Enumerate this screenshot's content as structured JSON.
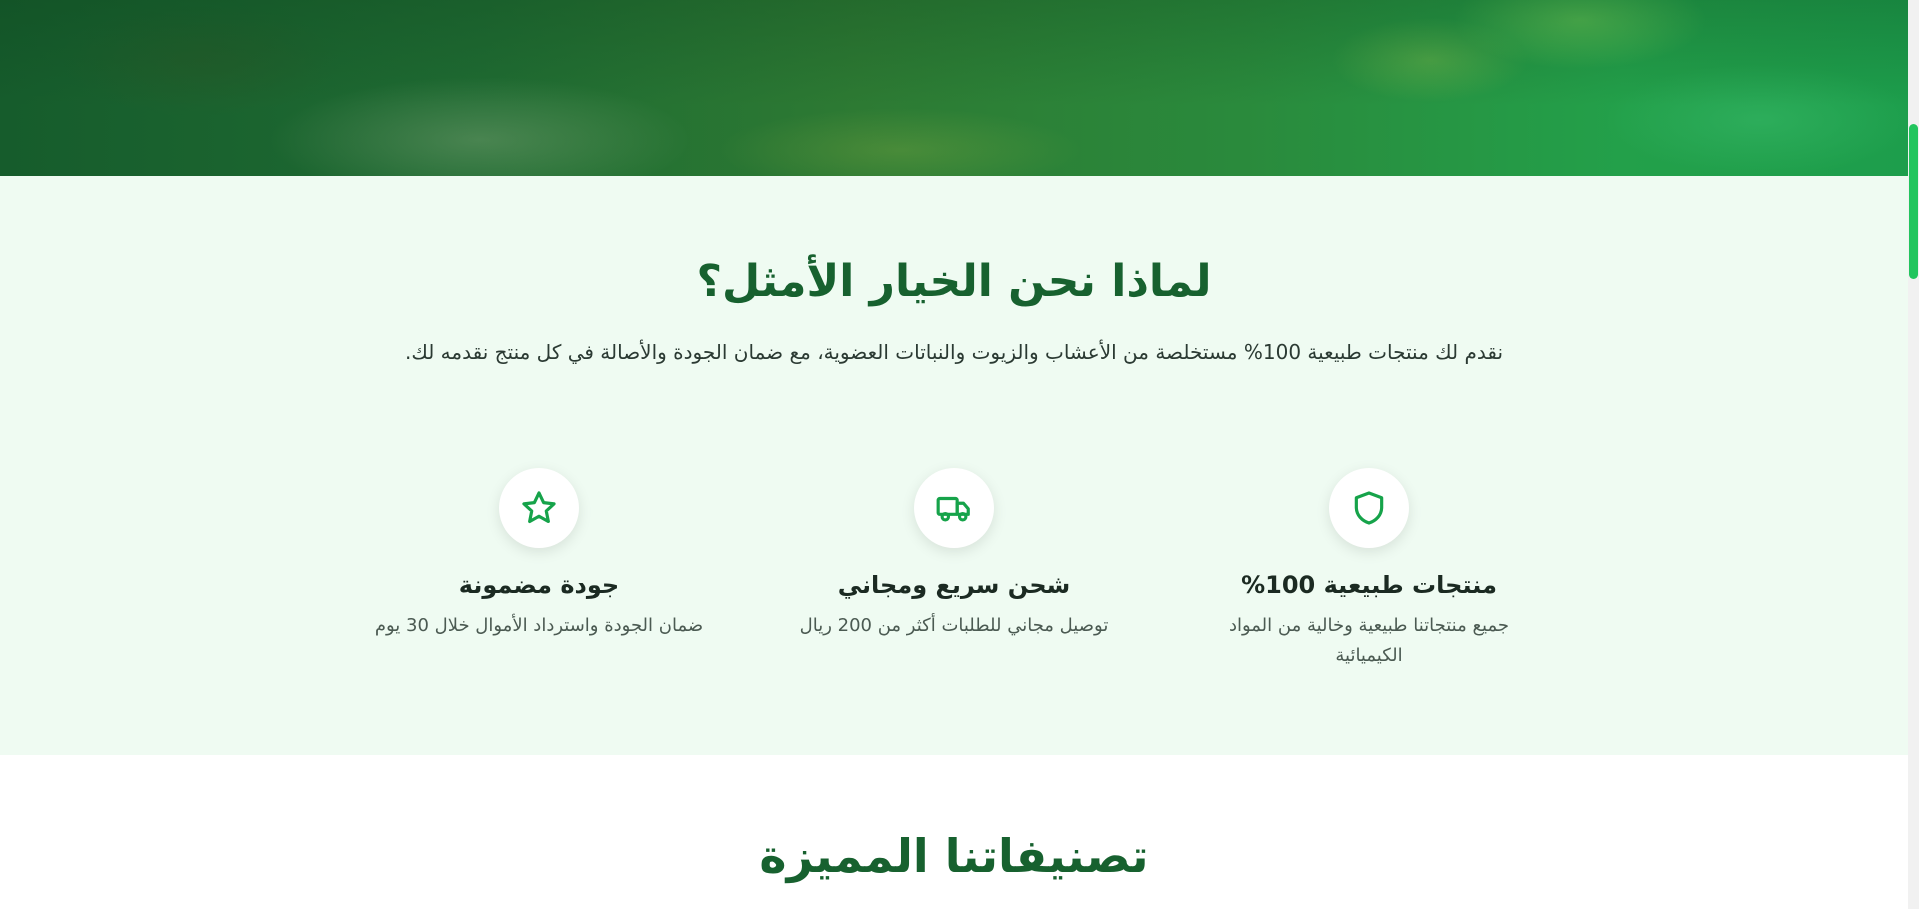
{
  "why": {
    "title": "لماذا نحن الخيار الأمثل؟",
    "subtitle": "نقدم لك منتجات طبيعية 100% مستخلصة من الأعشاب والزيوت والنباتات العضوية، مع ضمان الجودة والأصالة في كل منتج نقدمه لك.",
    "features": [
      {
        "icon": "shield-icon",
        "title": "منتجات طبيعية 100%",
        "desc": "جميع منتجاتنا طبيعية وخالية من المواد الكيميائية"
      },
      {
        "icon": "truck-icon",
        "title": "شحن سريع ومجاني",
        "desc": "توصيل مجاني للطلبات أكثر من 200 ريال"
      },
      {
        "icon": "star-icon",
        "title": "جودة مضمونة",
        "desc": "ضمان الجودة واسترداد الأموال خلال 30 يوم"
      }
    ]
  },
  "categories": {
    "title": "تصنيفاتنا المميزة"
  },
  "colors": {
    "accent": "#16a34a",
    "heading": "#17612f",
    "section_bg": "#effbf2",
    "scroll_thumb": "#22c55e"
  }
}
